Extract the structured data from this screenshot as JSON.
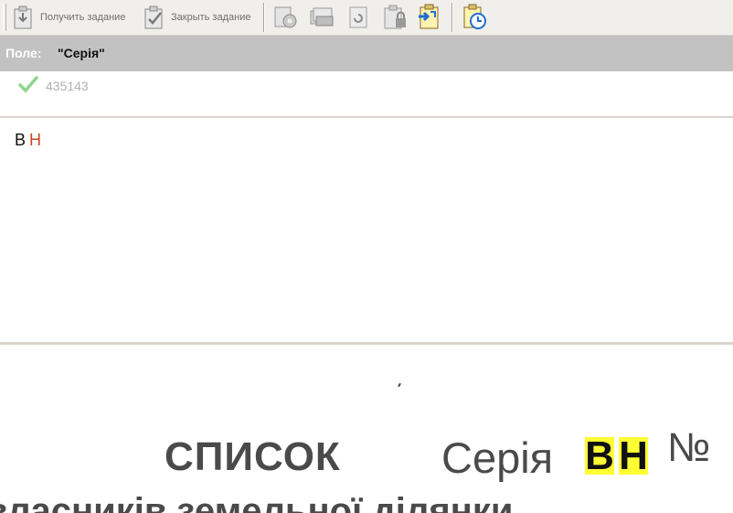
{
  "toolbar": {
    "get_task_label": "Получить задание",
    "close_task_label": "Закрыть задание"
  },
  "field": {
    "label": "Поле:",
    "name": "\"Серія\""
  },
  "previous_value": "435143",
  "input": {
    "char1": "В",
    "char2": "Н"
  },
  "document": {
    "title": "СПИСОК",
    "series_label": "Серія",
    "series_char1": "В",
    "series_char2": "Н",
    "number_sign": "№",
    "subtitle": "власників земельної ділянки"
  },
  "colors": {
    "highlight": "#ffff33",
    "error_char": "#c8461c"
  }
}
